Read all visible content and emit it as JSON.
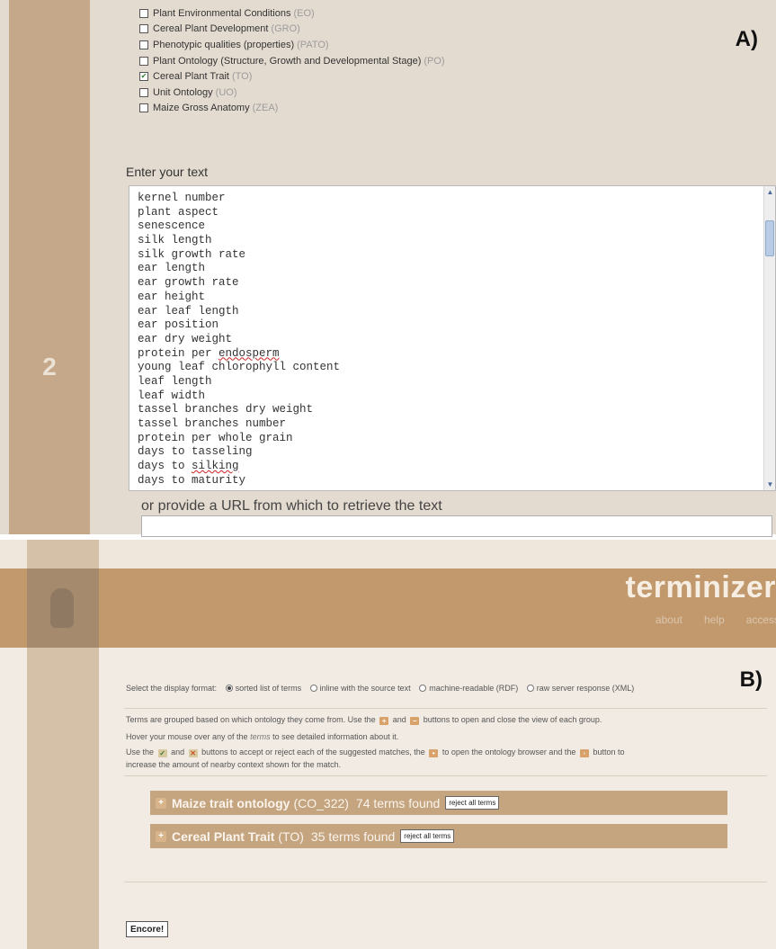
{
  "panel_a": {
    "label": "A)",
    "step_number": "2",
    "ontologies": [
      {
        "name": "Plant Environmental Conditions",
        "abbr": "(EO)",
        "checked": false
      },
      {
        "name": "Cereal Plant Development",
        "abbr": "(GRO)",
        "checked": false
      },
      {
        "name": "Phenotypic qualities (properties)",
        "abbr": "(PATO)",
        "checked": false
      },
      {
        "name": "Plant Ontology (Structure, Growth and Developmental Stage)",
        "abbr": "(PO)",
        "checked": false
      },
      {
        "name": "Cereal Plant Trait",
        "abbr": "(TO)",
        "checked": true
      },
      {
        "name": "Unit Ontology",
        "abbr": "(UO)",
        "checked": false
      },
      {
        "name": "Maize Gross Anatomy",
        "abbr": "(ZEA)",
        "checked": false
      }
    ],
    "enter_text_label": "Enter your text",
    "text_lines": [
      "kernel number",
      "plant aspect",
      "senescence",
      "silk length",
      "silk growth rate",
      "ear length",
      "ear growth rate",
      "ear height",
      "ear leaf length",
      "ear position",
      "ear dry weight",
      "protein per endosperm",
      "young leaf chlorophyll content",
      "leaf length",
      "leaf width",
      "tassel branches dry weight",
      "tassel branches number",
      "protein per whole grain",
      "days to tasseling",
      "days to silking",
      "days to maturity"
    ],
    "url_label": "or provide a URL from which to retrieve the text",
    "url_value": ""
  },
  "panel_b": {
    "label": "B)",
    "brand": "terminizer",
    "nav": [
      "about",
      "help",
      "access"
    ],
    "format_prompt": "Select the display format:",
    "formats": [
      {
        "label": "sorted list of terms",
        "selected": true
      },
      {
        "label": "inline with the source text",
        "selected": false
      },
      {
        "label": "machine-readable (RDF)",
        "selected": false
      },
      {
        "label": "raw server response (XML)",
        "selected": false
      }
    ],
    "info": {
      "line1_a": "Terms are grouped based on which ontology they come from. Use the",
      "line1_b": "and",
      "line1_c": "buttons to open and close the view of each group.",
      "line2_a": "Hover your mouse over any of the",
      "line2_terms": "terms",
      "line2_b": "to see detailed information about it.",
      "line3_a": "Use the",
      "line3_b": "and",
      "line3_c": "buttons to accept or reject each of the suggested matches, the",
      "line3_d": "to open the ontology browser and the",
      "line3_e": "button to",
      "line4": "increase the amount of nearby context shown for the match."
    },
    "groups": [
      {
        "name": "Maize trait ontology",
        "abbr": "(CO_322)",
        "count": "74 terms found",
        "reject_label": "reject all terms"
      },
      {
        "name": "Cereal Plant Trait",
        "abbr": "(TO)",
        "count": "35 terms found",
        "reject_label": "reject all terms"
      }
    ],
    "encore_label": "Encore!"
  },
  "colors": {
    "panel_a_bg": "#e4dbd0",
    "panel_a_sidebar": "#c5a889",
    "header_brown": "#c1996d",
    "group_bar": "#c5a57f"
  }
}
